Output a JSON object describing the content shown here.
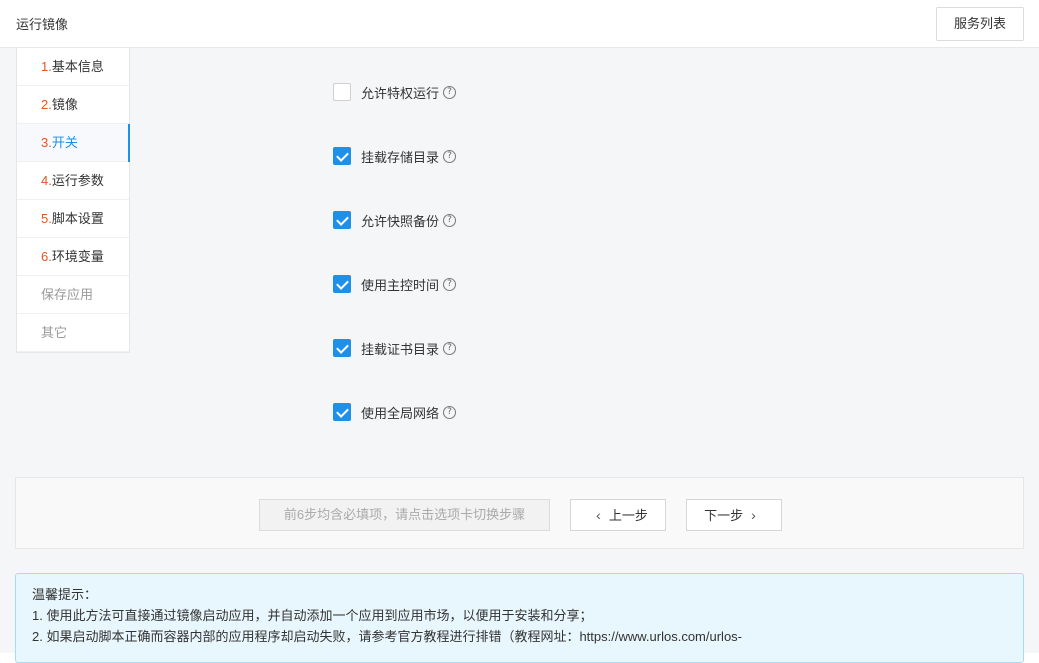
{
  "header": {
    "title": "运行镜像",
    "service_list_label": "服务列表"
  },
  "sidebar": {
    "items": [
      {
        "num": "1.",
        "label": "基本信息",
        "state": "normal"
      },
      {
        "num": "2.",
        "label": "镜像",
        "state": "normal"
      },
      {
        "num": "3.",
        "label": "开关",
        "state": "active"
      },
      {
        "num": "4.",
        "label": "运行参数",
        "state": "normal"
      },
      {
        "num": "5.",
        "label": "脚本设置",
        "state": "normal"
      },
      {
        "num": "6.",
        "label": "环境变量",
        "state": "normal"
      },
      {
        "num": "",
        "label": "保存应用",
        "state": "muted"
      },
      {
        "num": "",
        "label": "其它",
        "state": "muted"
      }
    ]
  },
  "switches": [
    {
      "label": "允许特权运行",
      "checked": false
    },
    {
      "label": "挂载存储目录",
      "checked": true
    },
    {
      "label": "允许快照备份",
      "checked": true
    },
    {
      "label": "使用主控时间",
      "checked": true
    },
    {
      "label": "挂载证书目录",
      "checked": true
    },
    {
      "label": "使用全局网络",
      "checked": true
    }
  ],
  "footer": {
    "hint": "前6步均含必填项，请点击选项卡切换步骤",
    "prev_label": "上一步",
    "next_label": "下一步"
  },
  "tips": {
    "title": "温馨提示：",
    "lines": [
      "1. 使用此方法可直接通过镜像启动应用，并自动添加一个应用到应用市场，以便用于安装和分享；",
      "2. 如果启动脚本正确而容器内部的应用程序却启动失败，请参考官方教程进行排错（教程网址：https://www.urlos.com/urlos-"
    ]
  },
  "icons": {
    "help": "question-circle-icon",
    "check": "check-icon",
    "prev": "chevron-left-icon",
    "next": "chevron-right-icon"
  },
  "colors": {
    "accent": "#1e90e8",
    "step_number": "#e8541e",
    "tips_background": "#e8f6fd"
  }
}
